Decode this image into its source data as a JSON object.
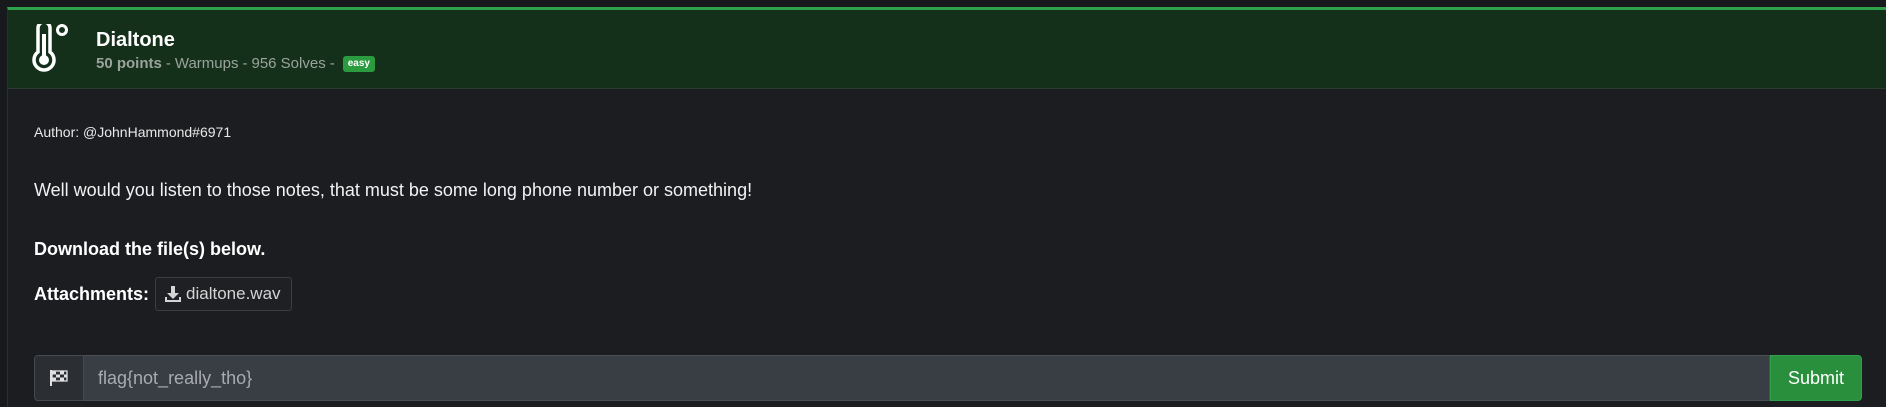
{
  "challenge": {
    "title": "Dialtone",
    "points": "50 points",
    "category": "Warmups",
    "solves": "956 Solves",
    "separator": "-",
    "difficulty": "easy",
    "category_icon": "thermometer-icon"
  },
  "body": {
    "author": "Author: @JohnHammond#6971",
    "description": "Well would you listen to those notes, that must be some long phone number or something!",
    "download_note": "Download the file(s) below.",
    "attachments_label": "Attachments:",
    "attachments": [
      {
        "name": "dialtone.wav",
        "icon": "download-icon"
      }
    ]
  },
  "flag_form": {
    "icon": "checkered-flag-icon",
    "placeholder": "flag{not_really_tho}",
    "submit_label": "Submit"
  },
  "colors": {
    "accent": "#2fa14a",
    "header_bg": "#15301a",
    "page_bg": "#1b1d20",
    "badge": "#2a9b3e"
  }
}
